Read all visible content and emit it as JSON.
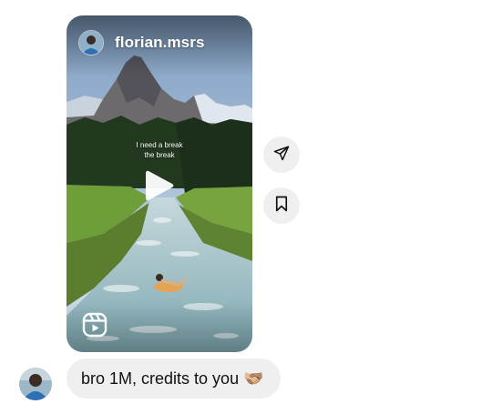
{
  "reel": {
    "username": "florian.msrs",
    "caption_lines": [
      "I need a break",
      "the break"
    ],
    "icons": {
      "play": "play-icon",
      "reels": "reels-icon",
      "avatar": "avatar"
    }
  },
  "actions": {
    "share_icon": "send-icon",
    "save_icon": "bookmark-icon"
  },
  "message": {
    "text": "bro 1M, credits to you 🫱🏼‍🫲🏽"
  },
  "colors": {
    "bubble_bg": "#efefef",
    "text": "#111111",
    "sky": "#9db7d6",
    "grass": "#5e8f32",
    "river": "#a7c4cc"
  }
}
